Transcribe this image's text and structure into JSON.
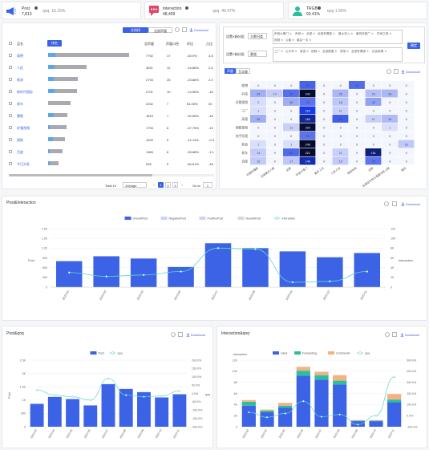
{
  "kpis": [
    {
      "name": "Post",
      "value": "7,813",
      "qoq": "qoq  -16.15%",
      "color": "#3c63e6"
    },
    {
      "name": "Interaction",
      "value": "48,409",
      "qoq": "qoq  -46.47%",
      "color": "#e0456b"
    },
    {
      "name": "TRGB",
      "value": "93.41%",
      "qoq": "qoq  1.95%",
      "color": "#2bbf9e"
    }
  ],
  "ranking": {
    "toggle": [
      "文档排",
      "全部声量"
    ],
    "download": "Download",
    "col_headers": [
      "品名",
      "排名",
      "总声量",
      "声量口径",
      "环比",
      "占比"
    ],
    "rows": [
      {
        "name": "高德",
        "vol": "7792",
        "n": "17",
        "chg": "-53.9%",
        "share": "4.8",
        "bar": 0.88,
        "blue": 0.08
      },
      {
        "name": "人民",
        "vol": "3521",
        "n": "12",
        "chg": "-15.86%",
        "share": "2.6",
        "bar": 0.42,
        "blue": 0.07
      },
      {
        "name": "新浪",
        "vol": "2793",
        "n": "25",
        "chg": "-23.88%",
        "share": "2.0",
        "bar": 0.32,
        "blue": 0.06
      },
      {
        "name": "新时代国际",
        "vol": "2701",
        "n": "10",
        "chg": "-13.58%",
        "share": "-16",
        "bar": 0.31,
        "blue": 0.07
      },
      {
        "name": "易车",
        "vol": "2032",
        "n": "7",
        "chg": "54.05%",
        "share": "30",
        "bar": 0.24,
        "blue": 0.0
      },
      {
        "name": "慧聪",
        "vol": "1819",
        "n": "7",
        "chg": "-32.68%",
        "share": "-18",
        "bar": 0.21,
        "blue": 0.06
      },
      {
        "name": "好看视频",
        "vol": "1793",
        "n": "8",
        "chg": "-47.75%",
        "share": "-13",
        "bar": 0.2,
        "blue": 0.02
      },
      {
        "name": "搜狗",
        "vol": "1529",
        "n": "6",
        "chg": "-12.13%",
        "share": "-0.3",
        "bar": 0.18,
        "blue": 0.05
      },
      {
        "name": "百度",
        "vol": "1383",
        "n": "8",
        "chg": "-33.88%",
        "share": "-1.1",
        "bar": 0.16,
        "blue": 0.02
      },
      {
        "name": "今日头条",
        "vol": "926",
        "n": "5",
        "chg": "-84.61%",
        "share": "-18",
        "bar": 0.11,
        "blue": 0.02
      }
    ],
    "pagination": {
      "total": "Total 10",
      "per_page": "10/page",
      "pages": [
        "1",
        "2",
        "3"
      ],
      "goto": "Go to",
      "goto_value": "1"
    }
  },
  "heatmap": {
    "x_axis_label": "设置X轴分组",
    "x_axis_value": "大数归类",
    "y_axis_label": "设置Y轴分组",
    "y_axis_value": "渠道",
    "x_tags": [
      "声音大嗓门",
      "声音",
      "全部",
      "全部有情感",
      "最大流入",
      "最有效推广",
      "时间之城",
      "视频",
      "公路",
      "最后一次"
    ],
    "y_tags": [
      "三厂",
      "公众号",
      "新浪",
      "视频",
      "全部数据",
      "其他",
      "全部有情感",
      "社会新闻"
    ],
    "confirm": "确定",
    "tabs": [
      "声量",
      "互动量"
    ],
    "download": "Download",
    "rows": [
      "微博",
      "抖音",
      "好看视频",
      "三厂",
      "高德",
      "搜狐视频",
      "快手短视",
      "新浪",
      "易车",
      "百度"
    ],
    "cols": [
      "中国热播剧",
      "全国重点人群",
      "全部",
      "声音大嗓门",
      "最多人流",
      "人来人往",
      "视频时间",
      "全部",
      "全国省市地方重要信息人群",
      "重庆"
    ],
    "values": [
      [
        0,
        0,
        0,
        87,
        0,
        0,
        81,
        0,
        0,
        0
      ],
      [
        34,
        14,
        79,
        242,
        0,
        29,
        0,
        23,
        28,
        0
      ],
      [
        2,
        0,
        36,
        76,
        0,
        18,
        0,
        43,
        0,
        0
      ],
      [
        1,
        0,
        0,
        115,
        0,
        11,
        0,
        0,
        0,
        0
      ],
      [
        35,
        0,
        0,
        160,
        0,
        91,
        0,
        11,
        26,
        0
      ],
      [
        0,
        0,
        11,
        220,
        0,
        0,
        0,
        0,
        1,
        0
      ],
      [
        0,
        0,
        0,
        76,
        0,
        0,
        0,
        0,
        0,
        0
      ],
      [
        1,
        0,
        1,
        246,
        0,
        0,
        0,
        0,
        0,
        16
      ],
      [
        14,
        0,
        82,
        221,
        0,
        11,
        0,
        181,
        0,
        0
      ],
      [
        15,
        0,
        17,
        146,
        0,
        15,
        0,
        75,
        0,
        0
      ]
    ]
  },
  "post_interaction": {
    "title": "Post&Interaction",
    "download": "Download",
    "legend": [
      "OverallPost",
      "NegativePost",
      "PositivePost",
      "NeutralPost",
      "Interaction"
    ],
    "left_axis_label": "Post",
    "right_axis_label": "Interaction",
    "chart_data": {
      "type": "bar",
      "categories": [
        "2023-03",
        "2023-04",
        "2023-05",
        "2023-06",
        "2023-07",
        "2023-08",
        "2023-09",
        "2023-10",
        "2023-11"
      ],
      "series": [
        {
          "name": "OverallPost",
          "values": [
            800,
            950,
            880,
            620,
            1350,
            1200,
            1100,
            920,
            1050
          ]
        },
        {
          "name": "Interaction",
          "values": [
            3000,
            2200,
            2500,
            3200,
            8000,
            7800,
            1000,
            1200,
            3200
          ]
        }
      ],
      "ylim_left": [
        0,
        1800
      ],
      "ylim_right": [
        0,
        12000
      ],
      "yticks_left": [
        "0",
        "300",
        "600",
        "900",
        "1.2K",
        "1.5K",
        "1.8K"
      ],
      "yticks_right": [
        "0",
        "2K",
        "4K",
        "6K",
        "8K",
        "10K",
        "12K"
      ]
    }
  },
  "post_qoq": {
    "title": "Post&qoq",
    "download": "Download",
    "legend": [
      "Post",
      "qoq"
    ],
    "left_axis_label": "Post",
    "right_axis_label": "qoq",
    "chart_data": {
      "type": "bar",
      "categories": [
        "2023-03",
        "2023-04",
        "2023-05",
        "2023-06",
        "2023-07",
        "2023-08",
        "2023-09",
        "2023-10",
        "2023-11"
      ],
      "series": [
        {
          "name": "Post",
          "values": [
            860,
            1120,
            1040,
            800,
            1600,
            1420,
            1300,
            1100,
            1220
          ]
        },
        {
          "name": "qoq",
          "values": [
            20,
            -10,
            -20,
            -40,
            90,
            -10,
            -20,
            -15,
            15
          ]
        }
      ],
      "ylim_left": [
        0,
        2500
      ],
      "ylim_right": [
        -200,
        200
      ],
      "yticks_left": [
        "0",
        "500",
        "1K",
        "1.5K",
        "2K",
        "2.5K"
      ],
      "yticks_right": [
        "-200.0%",
        "-150.0%",
        "-100.0%",
        "-50.0%",
        "0.0%",
        "50.0%",
        "100.0%",
        "150.0%",
        "200.0%"
      ]
    }
  },
  "interaction_qoq": {
    "title": "Interaction&qoq",
    "download": "Download",
    "legend": [
      "Likes",
      "Forwarding",
      "Comments",
      "qoq"
    ],
    "left_axis_label": "Interaction",
    "right_axis_label": "",
    "chart_data": {
      "type": "bar",
      "categories": [
        "2023-03",
        "2023-04",
        "2023-05",
        "2023-06",
        "2023-07",
        "2023-08",
        "2023-09",
        "2023-10",
        "2023-11"
      ],
      "series": [
        {
          "name": "Likes",
          "values": [
            3800,
            2600,
            3400,
            9200,
            8500,
            7600,
            1000,
            1000,
            4400
          ]
        },
        {
          "name": "Forwarding",
          "values": [
            700,
            300,
            400,
            900,
            800,
            700,
            100,
            100,
            500
          ]
        },
        {
          "name": "Comments",
          "values": [
            300,
            200,
            500,
            700,
            600,
            1000,
            100,
            100,
            1000
          ]
        },
        {
          "name": "qoq",
          "values": [
            30,
            -15,
            20,
            130,
            -10,
            10,
            -80,
            0,
            350
          ]
        }
      ],
      "ylim_left": [
        0,
        12000
      ],
      "ylim_right": [
        -100,
        500
      ],
      "yticks_left": [
        "0",
        "2K",
        "4K",
        "6K",
        "8K",
        "10K",
        "12K"
      ],
      "yticks_right": [
        "-100.0%",
        "0.0%",
        "100.0%",
        "200.0%",
        "300.0%",
        "400.0%",
        "500.0%"
      ]
    }
  },
  "colors": {
    "primary": "#3c63e6",
    "teal": "#5fd6c8",
    "grey_bar": "#a9aab0",
    "orange": "#f4b183",
    "green": "#2bbf9e"
  }
}
